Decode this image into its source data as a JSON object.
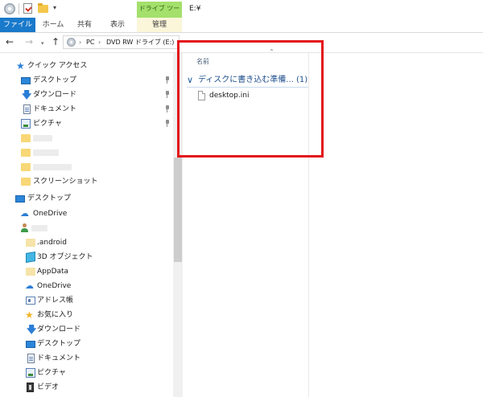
{
  "title_bar": {
    "path_title": "E:¥",
    "quick_access_dropdown": "▾"
  },
  "ribbon": {
    "context_label": "ドライブ ツール",
    "tabs": {
      "file": "ファイル",
      "home": "ホーム",
      "share": "共有",
      "view": "表示",
      "manage": "管理"
    }
  },
  "address_bar": {
    "back": "←",
    "forward": "→",
    "recent": "▾",
    "up": "↑",
    "separator": "›",
    "crumbs": [
      "PC",
      "DVD RW ドライブ (E:)"
    ]
  },
  "nav_pane": {
    "quick_access": "クイック アクセス",
    "qa_items": [
      {
        "label": "デスクトップ",
        "icon": "desktop-icon"
      },
      {
        "label": "ダウンロード",
        "icon": "download-icon"
      },
      {
        "label": "ドキュメント",
        "icon": "documents-icon"
      },
      {
        "label": "ピクチャ",
        "icon": "pictures-icon"
      }
    ],
    "screenshot_folder": "スクリーンショット",
    "desktop_root": "デスクトップ",
    "onedrive": "OneDrive",
    "user_items": [
      {
        "label": ".android",
        "icon": "folder-icon"
      },
      {
        "label": "3D オブジェクト",
        "icon": "3d-objects-icon"
      },
      {
        "label": "AppData",
        "icon": "folder-icon"
      },
      {
        "label": "OneDrive",
        "icon": "onedrive-icon"
      },
      {
        "label": "アドレス帳",
        "icon": "contacts-icon"
      },
      {
        "label": "お気に入り",
        "icon": "favorites-icon"
      },
      {
        "label": "ダウンロード",
        "icon": "download-icon"
      },
      {
        "label": "デスクトップ",
        "icon": "desktop-icon"
      },
      {
        "label": "ドキュメント",
        "icon": "documents-icon"
      },
      {
        "label": "ピクチャ",
        "icon": "pictures-icon"
      },
      {
        "label": "ビデオ",
        "icon": "videos-icon"
      }
    ]
  },
  "content": {
    "sort_indicator": "⌃",
    "column_name": "名前",
    "group_chevron": "∨",
    "group_title": "ディスクに書き込む準備... (1)",
    "files": [
      {
        "name": "desktop.ini",
        "icon": "settings-file-icon"
      }
    ]
  },
  "colors": {
    "file_tab": "#1979ca",
    "context_tab": "#a4e06c",
    "highlight": "#e3141a",
    "group_title": "#1e4f8c"
  }
}
